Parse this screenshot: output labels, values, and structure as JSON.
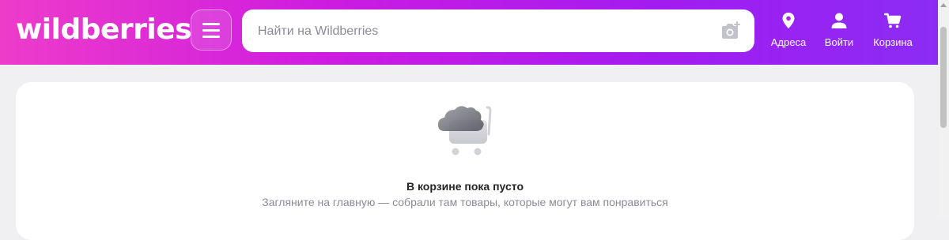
{
  "header": {
    "logo": "wildberries",
    "search": {
      "placeholder": "Найти на Wildberries",
      "value": ""
    },
    "nav": [
      {
        "label": "Адреса",
        "icon": "location-pin-icon"
      },
      {
        "label": "Войти",
        "icon": "user-icon"
      },
      {
        "label": "Корзина",
        "icon": "cart-icon"
      }
    ],
    "gradient": [
      "#ed3cca",
      "#cd1ce0",
      "#a31bf0",
      "#8b2cf5"
    ]
  },
  "cart": {
    "title": "В корзине пока пусто",
    "subtitle": "Загляните на главную — собрали там товары, которые могут вам понравиться"
  }
}
